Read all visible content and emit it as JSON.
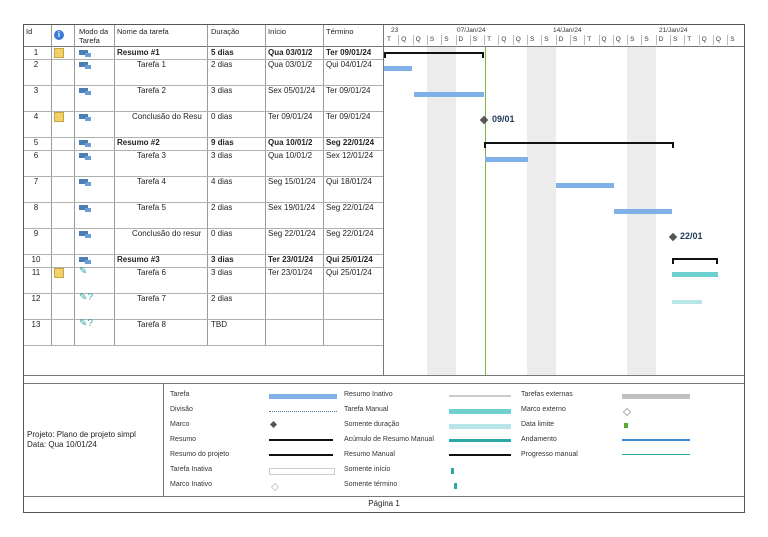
{
  "columns": {
    "id": "Id",
    "mode": "Modo da Tarefa",
    "mode_line1": "Modo da",
    "mode_line2": "Tarefa",
    "name": "Nome da tarefa",
    "duration": "Duração",
    "start": "Início",
    "finish": "Término"
  },
  "timeline": {
    "top_labels": [
      "23",
      "07/Jan/24",
      "14/Jan/24",
      "21/Jan/24"
    ],
    "day_letters": [
      "T",
      "Q",
      "Q",
      "S",
      "S",
      "D",
      "S",
      "T",
      "Q",
      "Q",
      "S",
      "S",
      "D",
      "S",
      "T",
      "Q",
      "Q",
      "S",
      "S",
      "D",
      "S",
      "T",
      "Q",
      "Q",
      "S"
    ]
  },
  "rows": [
    {
      "id": "1",
      "has_note": true,
      "mode": "auto",
      "name": "Resumo #1",
      "bold": true,
      "indent": 0,
      "duration": "5 dias",
      "start": "Qua 03/01/2",
      "finish": "Ter 09/01/24"
    },
    {
      "id": "2",
      "has_note": false,
      "mode": "auto",
      "name": "Tarefa 1",
      "bold": false,
      "indent": 1,
      "duration": "2 dias",
      "start": "Qua 03/01/2",
      "finish": "Qui 04/01/24"
    },
    {
      "id": "3",
      "has_note": false,
      "mode": "auto",
      "name": "Tarefa 2",
      "bold": false,
      "indent": 1,
      "duration": "3 dias",
      "start": "Sex 05/01/24",
      "finish": "Ter 09/01/24"
    },
    {
      "id": "4",
      "has_note": true,
      "mode": "auto",
      "name": "Conclusão do Resu",
      "bold": false,
      "indent": 1,
      "duration": "0 dias",
      "start": "Ter 09/01/24",
      "finish": "Ter 09/01/24"
    },
    {
      "id": "5",
      "has_note": false,
      "mode": "auto",
      "name": "Resumo #2",
      "bold": true,
      "indent": 0,
      "duration": "9 dias",
      "start": "Qua 10/01/2",
      "finish": "Seg 22/01/24"
    },
    {
      "id": "6",
      "has_note": false,
      "mode": "auto",
      "name": "Tarefa 3",
      "bold": false,
      "indent": 1,
      "duration": "3 dias",
      "start": "Qua 10/01/2",
      "finish": "Sex 12/01/24"
    },
    {
      "id": "7",
      "has_note": false,
      "mode": "auto",
      "name": "Tarefa 4",
      "bold": false,
      "indent": 1,
      "duration": "4 dias",
      "start": "Seg 15/01/24",
      "finish": "Qui 18/01/24"
    },
    {
      "id": "8",
      "has_note": false,
      "mode": "auto",
      "name": "Tarefa 5",
      "bold": false,
      "indent": 1,
      "duration": "2 dias",
      "start": "Sex 19/01/24",
      "finish": "Seg 22/01/24"
    },
    {
      "id": "9",
      "has_note": false,
      "mode": "auto",
      "name": "Conclusão do resur",
      "bold": false,
      "indent": 1,
      "duration": "0 dias",
      "start": "Seg 22/01/24",
      "finish": "Seg 22/01/24"
    },
    {
      "id": "10",
      "has_note": false,
      "mode": "auto",
      "name": "Resumo #3",
      "bold": true,
      "indent": 0,
      "duration": "3 dias",
      "start": "Ter 23/01/24",
      "finish": "Qui 25/01/24"
    },
    {
      "id": "11",
      "has_note": true,
      "mode": "manual",
      "name": "Tarefa 6",
      "bold": false,
      "indent": 1,
      "duration": "3 dias",
      "start": "Ter 23/01/24",
      "finish": "Qui 25/01/24"
    },
    {
      "id": "12",
      "has_note": false,
      "mode": "manual-q",
      "name": "Tarefa 7",
      "bold": false,
      "indent": 1,
      "duration": "2 dias",
      "start": "",
      "finish": ""
    },
    {
      "id": "13",
      "has_note": false,
      "mode": "manual-q",
      "name": "Tarefa 8",
      "bold": false,
      "indent": 1,
      "duration": "TBD",
      "start": "",
      "finish": ""
    }
  ],
  "milestones": [
    "09/01",
    "22/01"
  ],
  "legend": {
    "project_info": "Projeto: Plano de projeto simpl\nData: Qua 10/01/24",
    "col1": [
      "Tarefa",
      "Divisão",
      "Marco",
      "Resumo",
      "Resumo do projeto",
      "Tarefa Inativa",
      "Marco Inativo"
    ],
    "col2": [
      "Resumo Inativo",
      "Tarefa Manual",
      "Somente duração",
      "Acúmulo de Resumo Manual",
      "Resumo Manual",
      "Somente início",
      "Somente término"
    ],
    "col3": [
      "Tarefas externas",
      "Marco externo",
      "Data limite",
      "Andamento",
      "Progresso manual"
    ]
  },
  "footer": "Página 1",
  "colors": {
    "task": "#7fb0e8",
    "manual": "#6fd0d0",
    "summary": "#111111",
    "grid": "#9a9a9a",
    "shade": "#ececec"
  }
}
